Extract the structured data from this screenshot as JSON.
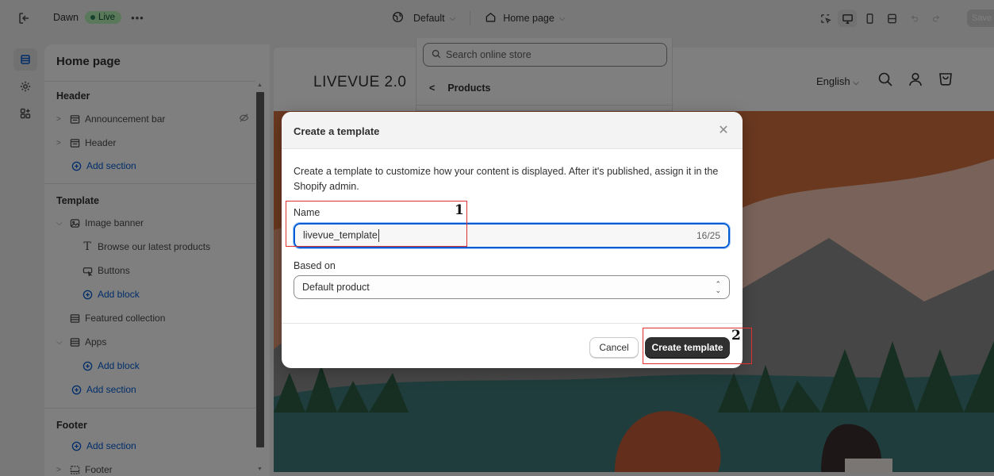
{
  "topbar": {
    "theme_name": "Dawn",
    "live_label": "Live",
    "more_label": "•••",
    "default_label": "Default",
    "page_label": "Home page",
    "save_label": "Save"
  },
  "sidebar": {
    "title": "Home page",
    "header_group": "Header",
    "header_items": [
      {
        "label": "Announcement bar"
      },
      {
        "label": "Header"
      }
    ],
    "header_add": "Add section",
    "template_group": "Template",
    "image_banner": "Image banner",
    "image_banner_blocks": [
      {
        "label": "Browse our latest products"
      },
      {
        "label": "Buttons"
      }
    ],
    "add_block_1": "Add block",
    "featured_collection": "Featured collection",
    "apps": "Apps",
    "add_block_2": "Add block",
    "template_add": "Add section",
    "footer_group": "Footer",
    "footer_add": "Add section",
    "footer_item": "Footer"
  },
  "preview": {
    "logo": "LIVEVUE 2.0",
    "language": "English"
  },
  "search": {
    "placeholder": "Search online store",
    "back_label": "Products"
  },
  "modal": {
    "title": "Create a template",
    "description": "Create a template to customize how your content is displayed. After it's published, assign it in the Shopify admin.",
    "name_label": "Name",
    "name_value": "livevue_template",
    "name_count": "16/25",
    "based_on_label": "Based on",
    "based_on_value": "Default product",
    "cancel_label": "Cancel",
    "create_label": "Create template"
  },
  "annotations": {
    "step1": "1",
    "step2": "2"
  },
  "colors": {
    "accent": "#005bd3",
    "annotation": "#e03131",
    "primary_button": "#303030"
  }
}
